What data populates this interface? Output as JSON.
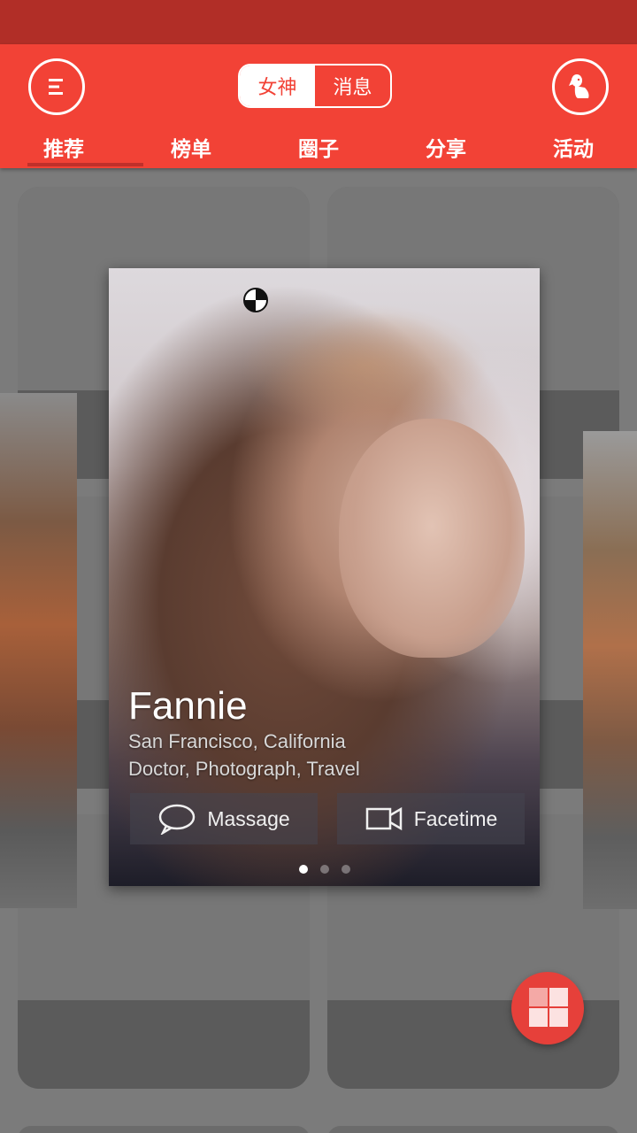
{
  "top_segment": {
    "goddess": "女神",
    "messages": "消息"
  },
  "tabs": [
    {
      "label": "推荐"
    },
    {
      "label": "榜单"
    },
    {
      "label": "圈子"
    },
    {
      "label": "分享"
    },
    {
      "label": "活动"
    }
  ],
  "profile": {
    "name": "Fannie",
    "location": "San Francisco, California",
    "occupation": "Doctor, Photograph, Travel",
    "message_label": "Massage",
    "facetime_label": "Facetime",
    "page_dots": {
      "count": 3,
      "active": 1
    }
  },
  "colors": {
    "status_bar": "#b12e27",
    "app_bar": "#f24236",
    "fab": "#e6403a"
  }
}
